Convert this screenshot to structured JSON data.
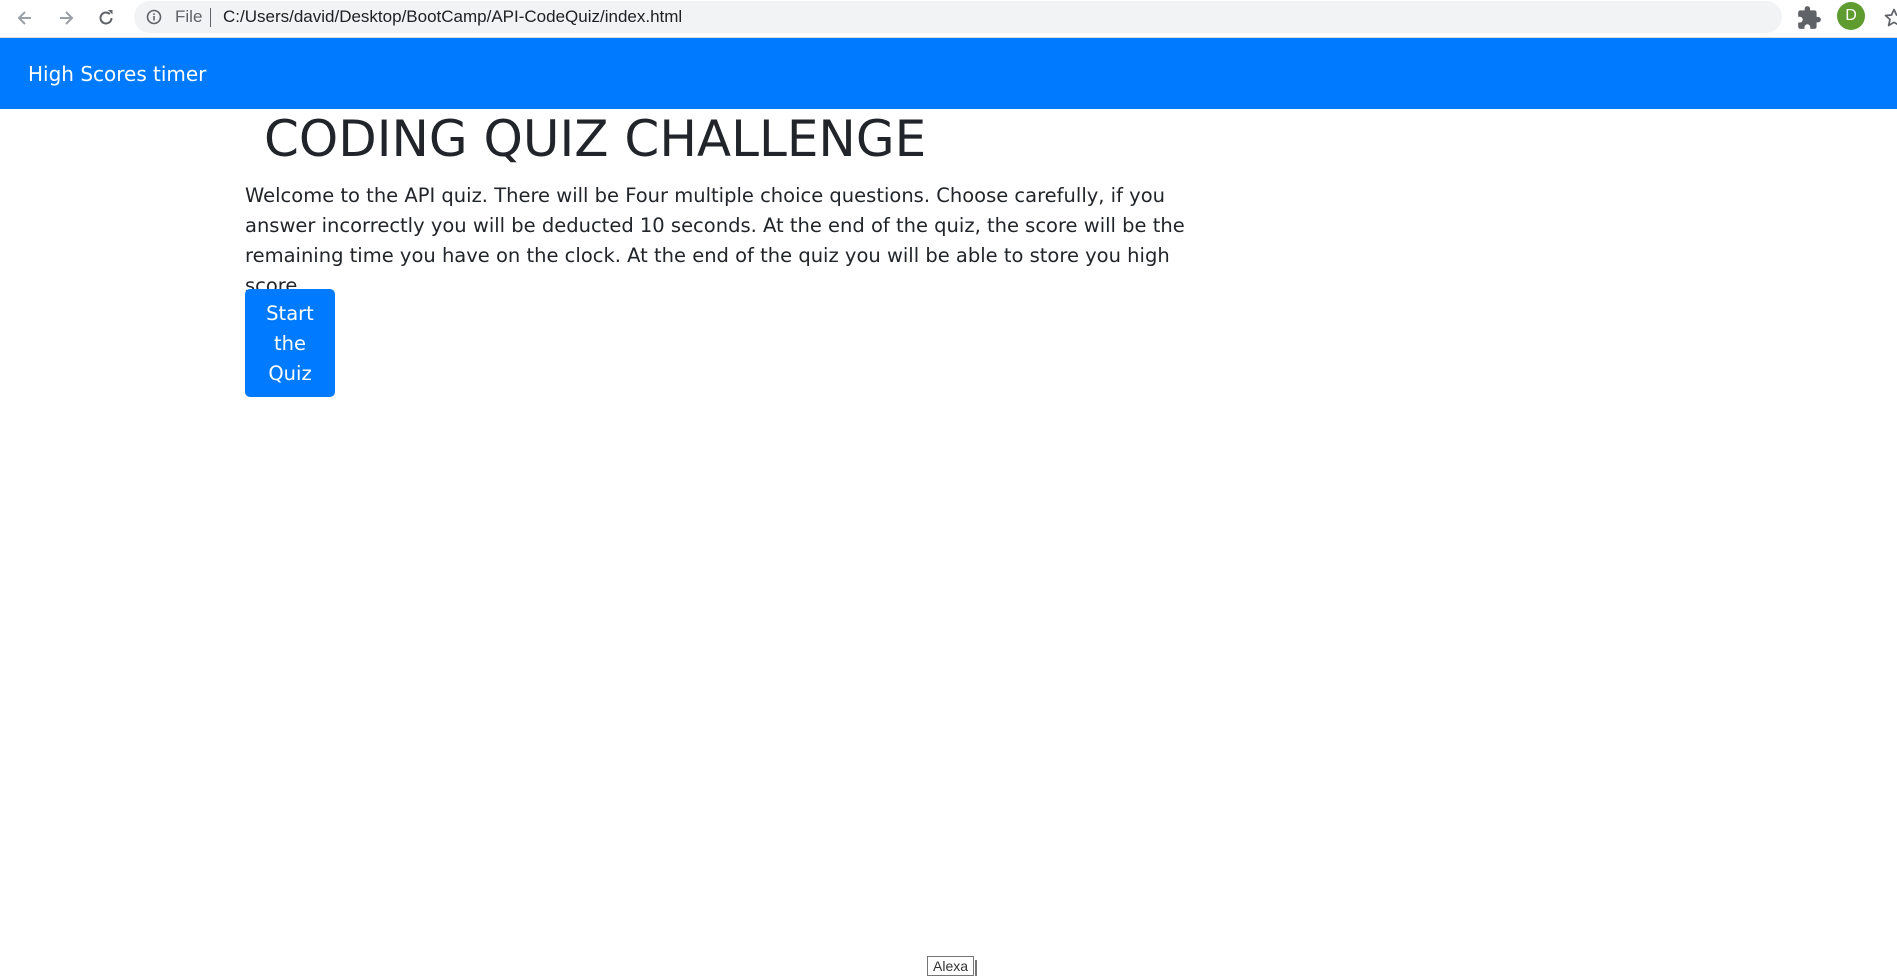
{
  "browser": {
    "scheme_label": "File",
    "url": "C:/Users/david/Desktop/BootCamp/API-CodeQuiz/index.html",
    "avatar_letter": "D",
    "avatar_color": "#5e9c2f",
    "icons": [
      "back-icon",
      "forward-icon",
      "reload-icon",
      "info-icon",
      "star-icon",
      "extensions-icon"
    ]
  },
  "navbar": {
    "background": "#007bff",
    "links": [
      {
        "label": "High Scores"
      },
      {
        "label": "timer"
      }
    ]
  },
  "main": {
    "title": "CODING QUIZ CHALLENGE",
    "intro": "Welcome to the API quiz. There will be Four multiple choice questions. Choose carefully, if you answer incorrectly you will be deducted 10 seconds. At the end of the quiz, the score will be the remaining time you have on the clock. At the end of the quiz you will be able to store you high score.",
    "start_button": "Start the Quiz"
  },
  "footer": {
    "tag_label": "Alexa"
  }
}
